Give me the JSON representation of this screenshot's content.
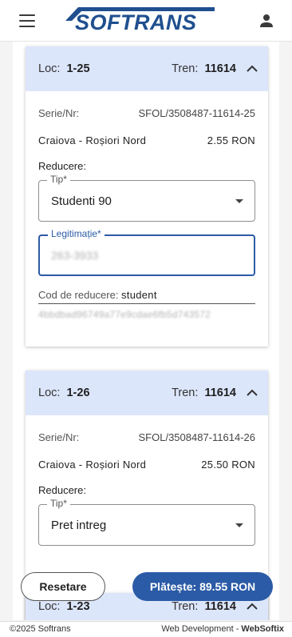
{
  "header": {
    "logo_text": "SOFTRANS",
    "brand_color": "#1f4f8f",
    "menu_icon": "menu-icon",
    "user_icon": "account-icon"
  },
  "tickets": [
    {
      "loc_label": "Loc:",
      "loc_value": "1-25",
      "tren_label": "Tren:",
      "tren_value": "11614",
      "expanded": true,
      "serie_label": "Serie/Nr:",
      "serie_value": "SFOL/3508487-11614-25",
      "route": "Craiova - Roșiori Nord",
      "price": "2.55 RON",
      "reducere_label": "Reducere:",
      "tip_label": "Tip",
      "tip_value": "Studenti 90",
      "legitimatie_label": "Legitimație",
      "legitimatie_value": "263-3933",
      "cod_label": "Cod de reducere:",
      "cod_value": "student",
      "hash": "4bbdbad96749a77e9cdae6fb5d743572"
    },
    {
      "loc_label": "Loc:",
      "loc_value": "1-26",
      "tren_label": "Tren:",
      "tren_value": "11614",
      "expanded": true,
      "serie_label": "Serie/Nr:",
      "serie_value": "SFOL/3508487-11614-26",
      "route": "Craiova - Roșiori Nord",
      "price": "25.50 RON",
      "reducere_label": "Reducere:",
      "tip_label": "Tip",
      "tip_value": "Pret intreg"
    },
    {
      "loc_label": "Loc:",
      "loc_value": "1-23",
      "tren_label": "Tren:",
      "tren_value": "11614"
    }
  ],
  "actions": {
    "reset_label": "Resetare",
    "pay_label": "Plătește: 89.55 RON",
    "pay_color": "#2b5ba6"
  },
  "footer": {
    "copyright": "©2025 Softrans",
    "dev_prefix": "Web Development - ",
    "dev_company": "WebSoftix"
  }
}
